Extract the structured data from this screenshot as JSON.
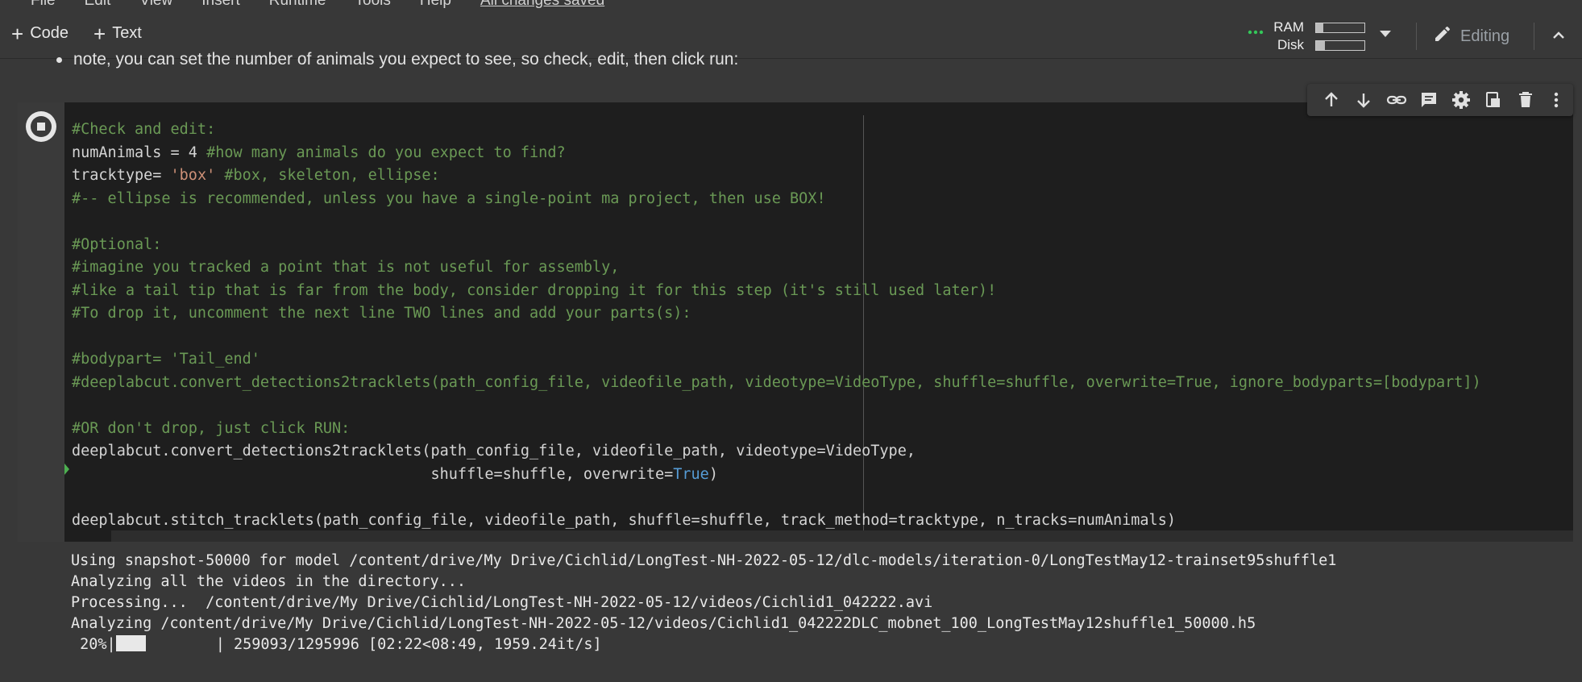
{
  "menu": {
    "items": [
      "File",
      "Edit",
      "View",
      "Insert",
      "Runtime",
      "Tools",
      "Help"
    ],
    "saved_status": "All changes saved"
  },
  "toolbar": {
    "code_label": "Code",
    "text_label": "Text",
    "ram_label": "RAM",
    "disk_label": "Disk",
    "ram_fraction": 0.15,
    "disk_fraction": 0.18,
    "editing_label": "Editing"
  },
  "text_cell": {
    "bullet": "note, you can set the number of animals you expect to see, so check, edit, then click run:"
  },
  "code_cell": {
    "lines": [
      [
        [
          "c",
          "#Check and edit:"
        ]
      ],
      [
        [
          "p",
          "numAnimals = 4 "
        ],
        [
          "c",
          "#how many animals do you expect to find?"
        ]
      ],
      [
        [
          "p",
          "tracktype= "
        ],
        [
          "s",
          "'box'"
        ],
        [
          "c",
          " #box, skeleton, ellipse:"
        ]
      ],
      [
        [
          "c",
          "#-- ellipse is recommended, unless you have a single-point ma project, then use BOX!"
        ]
      ],
      [],
      [
        [
          "c",
          "#Optional:"
        ]
      ],
      [
        [
          "c",
          "#imagine you tracked a point that is not useful for assembly,"
        ]
      ],
      [
        [
          "c",
          "#like a tail tip that is far from the body, consider dropping it for this step (it's still used later)!"
        ]
      ],
      [
        [
          "c",
          "#To drop it, uncomment the next line TWO lines and add your parts(s):"
        ]
      ],
      [],
      [
        [
          "c",
          "#bodypart= 'Tail_end'"
        ]
      ],
      [
        [
          "c",
          "#deeplabcut.convert_detections2tracklets(path_config_file, videofile_path, videotype=VideoType, shuffle=shuffle, overwrite=True, ignore_bodyparts=[bodypart])"
        ]
      ],
      [],
      [
        [
          "c",
          "#OR don't drop, just click RUN:"
        ]
      ],
      [
        [
          "p",
          "deeplabcut.convert_detections2tracklets(path_config_file, videofile_path, videotype=VideoType,"
        ]
      ],
      [
        [
          "p",
          "                                        shuffle=shuffle, overwrite="
        ],
        [
          "k",
          "True"
        ],
        [
          "p",
          ")"
        ]
      ],
      [],
      [
        [
          "p",
          "deeplabcut.stitch_tracklets(path_config_file, videofile_path, shuffle=shuffle, track_method=tracktype, n_tracks=numAnimals)"
        ]
      ]
    ]
  },
  "output": {
    "lines": [
      "Using snapshot-50000 for model /content/drive/My Drive/Cichlid/LongTest-NH-2022-05-12/dlc-models/iteration-0/LongTestMay12-trainset95shuffle1",
      "Analyzing all the videos in the directory...",
      "Processing...  /content/drive/My Drive/Cichlid/LongTest-NH-2022-05-12/videos/Cichlid1_042222.avi",
      "Analyzing /content/drive/My Drive/Cichlid/LongTest-NH-2022-05-12/videos/Cichlid1_042222DLC_mobnet_100_LongTestMay12shuffle1_50000.h5"
    ],
    "progress": {
      "percent": " 20%|",
      "fraction": 0.2,
      "rest": "| 259093/1295996 [02:22<08:49, 1959.24it/s]"
    }
  }
}
